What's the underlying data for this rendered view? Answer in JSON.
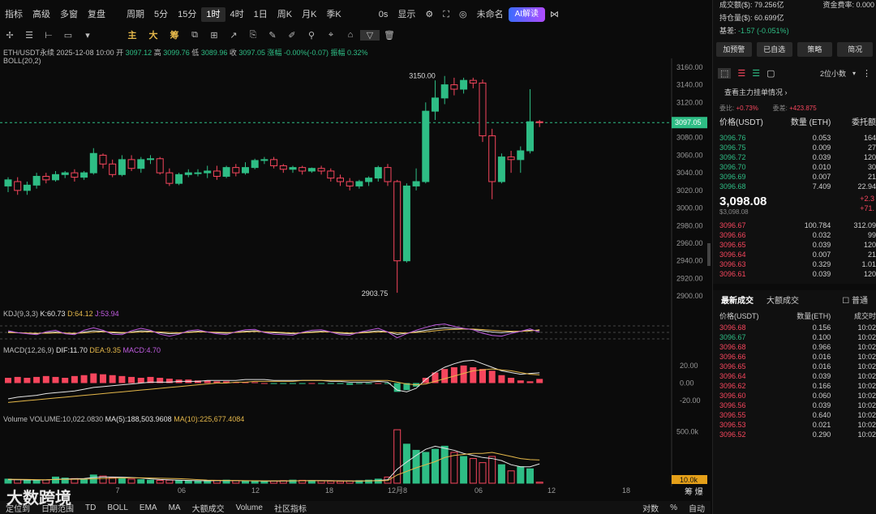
{
  "toolbar": {
    "items": [
      "指标",
      "高级",
      "多窗",
      "复盘",
      "周期",
      "5分",
      "15分",
      "1时",
      "4时",
      "1日",
      "周K",
      "月K",
      "季K",
      "0s",
      "显示",
      "未命名",
      "AI解读"
    ]
  },
  "drawbar": {
    "yellow": [
      "主",
      "大",
      "筹"
    ]
  },
  "info": {
    "pair": "ETH/USDT永续",
    "date": "2025-12-08 10:00",
    "open_label": "开",
    "open": "3097.12",
    "high_label": "高",
    "high": "3099.76",
    "low_label": "低",
    "low": "3089.96",
    "close_label": "收",
    "close": "3097.05",
    "chg": "涨幅 -0.00%(-0.07)",
    "amp": "振幅 0.32%"
  },
  "boll": "BOLL(20,2)",
  "kdj": {
    "label": "KDJ(9,3,3)",
    "k": "K:60.73",
    "d": "D:64.12",
    "j": "J:53.94"
  },
  "macd": {
    "label": "MACD(12,26,9)",
    "dif": "DIF:11.70",
    "dea": "DEA:9.35",
    "macd": "MACD:4.70"
  },
  "vol": {
    "label": "Volume",
    "v": "VOLUME:10,022.0830",
    "ma5": "MA(5):188,503.9608",
    "ma10": "MA(10):225,677.4084"
  },
  "price_ticks": [
    "3160.00",
    "3140.00",
    "3120.00",
    "3100.00",
    "3080.00",
    "3060.00",
    "3040.00",
    "3020.00",
    "3000.00",
    "2980.00",
    "2960.00",
    "2940.00",
    "2920.00",
    "2900.00"
  ],
  "last_price": "3097.05",
  "hi_label": "3150.00",
  "lo_label": "2903.75",
  "macd_ticks": [
    "20.00",
    "0.00",
    "-20.00"
  ],
  "vol_ticks": [
    "500.0k",
    "10.0k"
  ],
  "x_ticks": [
    "7",
    "06",
    "12",
    "18",
    "12月8",
    "06",
    "12",
    "18"
  ],
  "bottom": {
    "items": [
      "定位到",
      "日期范围",
      "TD",
      "BOLL",
      "EMA",
      "MA",
      "大额成交",
      "Volume",
      "社区指标",
      "对数",
      "%",
      "自动"
    ],
    "watermark": "大数跨境"
  },
  "right": {
    "stats": [
      {
        "k": "成交额($):",
        "v": "79.256亿"
      },
      {
        "k": "资金费率:",
        "v": "0.000"
      },
      {
        "k": "持仓量($):",
        "v": "60.699亿"
      },
      {
        "k": "基差:",
        "v": "-1.57 (-0.051%)"
      }
    ],
    "buttons": [
      "加预警",
      "已自选",
      "策略",
      "简况"
    ],
    "decimals": "2位小数",
    "depth_title": "查看主力挂单情况",
    "ratio": {
      "a_label": "委比:",
      "a": "+0.73%",
      "b_label": "委差:",
      "b": "+423.875"
    },
    "headers": [
      "价格(USDT)",
      "数量 (ETH)",
      "委托额"
    ],
    "asks": [
      [
        "3096.76",
        "0.053",
        "164"
      ],
      [
        "3096.75",
        "0.009",
        "27"
      ],
      [
        "3096.72",
        "0.039",
        "120"
      ],
      [
        "3096.70",
        "0.010",
        "30"
      ],
      [
        "3096.69",
        "0.007",
        "21"
      ],
      [
        "3096.68",
        "7.409",
        "22.94"
      ]
    ],
    "mid": {
      "price": "3,098.08",
      "usd": "$3,098.08",
      "chg": "+2.3",
      "chg2": "+71."
    },
    "bids": [
      [
        "3096.67",
        "100.784",
        "312.09"
      ],
      [
        "3096.66",
        "0.032",
        "99"
      ],
      [
        "3096.65",
        "0.039",
        "120"
      ],
      [
        "3096.64",
        "0.007",
        "21"
      ],
      [
        "3096.63",
        "0.329",
        "1.01"
      ],
      [
        "3096.61",
        "0.039",
        "120"
      ]
    ],
    "tabs": [
      "最新成交",
      "大额成交",
      "普通"
    ],
    "trade_headers": [
      "价格(USDT)",
      "数量(ETH)",
      "成交时"
    ],
    "trades": [
      [
        "3096.68",
        "0.156",
        "10:02"
      ],
      [
        "3096.67",
        "0.100",
        "10:02"
      ],
      [
        "3096.68",
        "0.966",
        "10:02"
      ],
      [
        "3096.66",
        "0.016",
        "10:02"
      ],
      [
        "3096.65",
        "0.016",
        "10:02"
      ],
      [
        "3096.64",
        "0.039",
        "10:02"
      ],
      [
        "3096.62",
        "0.166",
        "10:02"
      ],
      [
        "3096.60",
        "0.060",
        "10:02"
      ],
      [
        "3096.56",
        "0.039",
        "10:02"
      ],
      [
        "3096.55",
        "0.640",
        "10:02"
      ],
      [
        "3096.53",
        "0.021",
        "10:02"
      ],
      [
        "3096.52",
        "0.290",
        "10:02"
      ]
    ],
    "trade_colors": [
      "rd",
      "gr",
      "rd",
      "rd",
      "rd",
      "rd",
      "rd",
      "rd",
      "rd",
      "rd",
      "rd",
      "rd"
    ]
  },
  "colors": {
    "up": "#2ebd85",
    "down": "#f6465d",
    "k": "#e5e5e5",
    "d": "#e5b84a",
    "j": "#c05ce0"
  },
  "chart_data": {
    "type": "candlestick",
    "interval": "1h",
    "candles": [
      [
        3025,
        3032,
        3018,
        3035
      ],
      [
        3030,
        3020,
        3015,
        3035
      ],
      [
        3020,
        3026,
        3015,
        3030
      ],
      [
        3026,
        3036,
        3022,
        3040
      ],
      [
        3036,
        3032,
        3028,
        3040
      ],
      [
        3032,
        3038,
        3030,
        3042
      ],
      [
        3038,
        3040,
        3034,
        3042
      ],
      [
        3040,
        3035,
        3030,
        3044
      ],
      [
        3035,
        3040,
        3032,
        3042
      ],
      [
        3040,
        3062,
        3038,
        3068
      ],
      [
        3060,
        3050,
        3045,
        3062
      ],
      [
        3050,
        3038,
        3035,
        3055
      ],
      [
        3038,
        3055,
        3036,
        3060
      ],
      [
        3055,
        3045,
        3042,
        3060
      ],
      [
        3045,
        3055,
        3040,
        3058
      ],
      [
        3055,
        3056,
        3050,
        3060
      ],
      [
        3056,
        3040,
        3038,
        3058
      ],
      [
        3040,
        3028,
        3025,
        3045
      ],
      [
        3028,
        3038,
        3026,
        3040
      ],
      [
        3038,
        3040,
        3035,
        3044
      ],
      [
        3040,
        3040,
        3036,
        3044
      ],
      [
        3040,
        3042,
        3034,
        3048
      ],
      [
        3042,
        3036,
        3032,
        3048
      ],
      [
        3036,
        3046,
        3034,
        3048
      ],
      [
        3046,
        3040,
        3036,
        3050
      ],
      [
        3040,
        3046,
        3038,
        3052
      ],
      [
        3046,
        3054,
        3044,
        3056
      ],
      [
        3054,
        3055,
        3050,
        3058
      ],
      [
        3055,
        3048,
        3045,
        3058
      ],
      [
        3048,
        3044,
        3040,
        3050
      ],
      [
        3044,
        3046,
        3040,
        3048
      ],
      [
        3046,
        3042,
        3038,
        3048
      ],
      [
        3042,
        3045,
        3040,
        3046
      ],
      [
        3045,
        3042,
        3038,
        3048
      ],
      [
        3042,
        3034,
        3030,
        3045
      ],
      [
        3034,
        3030,
        3025,
        3038
      ],
      [
        3030,
        3025,
        3020,
        3034
      ],
      [
        3025,
        3030,
        3022,
        3032
      ],
      [
        3030,
        3034,
        3025,
        3036
      ],
      [
        3034,
        3046,
        3030,
        3048
      ],
      [
        3046,
        3030,
        3025,
        3050
      ],
      [
        3030,
        2940,
        2903.75,
        3032
      ],
      [
        2940,
        3025,
        2938,
        3028
      ],
      [
        3025,
        3030,
        3020,
        3045
      ],
      [
        3030,
        3110,
        3028,
        3120
      ],
      [
        3110,
        3125,
        3100,
        3145
      ],
      [
        3125,
        3140,
        3118,
        3150
      ],
      [
        3140,
        3135,
        3128,
        3148
      ],
      [
        3135,
        3145,
        3130,
        3148
      ],
      [
        3145,
        3142,
        3136,
        3148
      ],
      [
        3142,
        3082,
        3075,
        3146
      ],
      [
        3082,
        3030,
        3010,
        3090
      ],
      [
        3030,
        3058,
        3028,
        3062
      ],
      [
        3058,
        3055,
        3040,
        3065
      ],
      [
        3055,
        3065,
        3040,
        3070
      ],
      [
        3065,
        3098,
        3062,
        3135
      ],
      [
        3098,
        3097.05,
        3092,
        3100
      ]
    ],
    "kdj": {
      "k": [
        55,
        52,
        50,
        48,
        52,
        55,
        50,
        48,
        55,
        60,
        58,
        52,
        50,
        55,
        60,
        58,
        52,
        48,
        50,
        55,
        58,
        55,
        52,
        50,
        54,
        58,
        60,
        55,
        52,
        50,
        48,
        52,
        56,
        58,
        55,
        50,
        48,
        52,
        56,
        60,
        55,
        45,
        50,
        56,
        62,
        68,
        72,
        70,
        68,
        66,
        60,
        55,
        52,
        55,
        58,
        62,
        60.73
      ],
      "d": [
        52,
        52,
        51,
        50,
        50,
        51,
        51,
        50,
        51,
        54,
        56,
        55,
        53,
        53,
        55,
        56,
        55,
        53,
        52,
        53,
        55,
        55,
        54,
        53,
        53,
        55,
        57,
        56,
        55,
        53,
        51,
        51,
        53,
        55,
        55,
        53,
        51,
        51,
        53,
        55,
        55,
        52,
        51,
        53,
        56,
        60,
        64,
        66,
        67,
        67,
        65,
        62,
        59,
        58,
        58,
        59,
        64.12
      ],
      "j": [
        60,
        52,
        48,
        44,
        56,
        62,
        48,
        44,
        62,
        72,
        62,
        46,
        44,
        60,
        70,
        62,
        46,
        38,
        46,
        60,
        64,
        55,
        48,
        44,
        56,
        64,
        66,
        53,
        46,
        44,
        42,
        54,
        62,
        64,
        55,
        44,
        42,
        54,
        62,
        70,
        55,
        31,
        48,
        62,
        74,
        84,
        88,
        78,
        70,
        64,
        50,
        41,
        38,
        49,
        58,
        68,
        53.94
      ]
    },
    "macd": {
      "hist": [
        6,
        7,
        6,
        7,
        8,
        7,
        6,
        8,
        9,
        11,
        10,
        9,
        8,
        7,
        6,
        7,
        6,
        5,
        4,
        4,
        3,
        3,
        2,
        2,
        1,
        1,
        1,
        0,
        -1,
        -1,
        -1,
        -1,
        0,
        -1,
        -1,
        -1,
        -2,
        -1,
        -1,
        0,
        -1,
        -10,
        -8,
        -4,
        6,
        12,
        16,
        18,
        20,
        18,
        16,
        14,
        9,
        6,
        3,
        2,
        4.7
      ],
      "dif": [
        -18,
        -16,
        -15,
        -14,
        -12,
        -11,
        -10,
        -9,
        -7,
        -5,
        -4,
        -3,
        -2,
        -1,
        0,
        1,
        1,
        1,
        2,
        2,
        2,
        3,
        3,
        3,
        3,
        4,
        4,
        4,
        3,
        3,
        3,
        3,
        3,
        3,
        2,
        2,
        1,
        1,
        1,
        2,
        1,
        -8,
        -10,
        -6,
        4,
        12,
        18,
        22,
        25,
        26,
        22,
        18,
        14,
        12,
        10,
        11,
        11.7
      ],
      "dea": [
        -22,
        -21,
        -20,
        -19,
        -18,
        -17,
        -16,
        -15,
        -14,
        -13,
        -12,
        -11,
        -10,
        -9,
        -8,
        -7,
        -6,
        -5,
        -4,
        -3,
        -2,
        -1,
        0,
        0,
        1,
        1,
        2,
        2,
        2,
        2,
        2,
        3,
        3,
        3,
        3,
        3,
        3,
        3,
        3,
        3,
        3,
        1,
        -1,
        -2,
        -1,
        2,
        5,
        8,
        11,
        14,
        15,
        16,
        15,
        14,
        12,
        10,
        9.35
      ]
    },
    "volume": {
      "v": [
        40,
        35,
        30,
        28,
        32,
        60,
        50,
        45,
        40,
        80,
        70,
        55,
        45,
        40,
        35,
        30,
        28,
        30,
        25,
        22,
        20,
        25,
        28,
        30,
        25,
        22,
        20,
        18,
        20,
        25,
        30,
        28,
        25,
        22,
        20,
        18,
        22,
        25,
        30,
        40,
        60,
        520,
        380,
        320,
        300,
        330,
        360,
        300,
        260,
        240,
        200,
        260,
        180,
        120,
        160,
        140,
        10
      ],
      "ma5": [
        35,
        34,
        33,
        32,
        33,
        37,
        40,
        43,
        45,
        55,
        60,
        60,
        58,
        55,
        50,
        42,
        36,
        33,
        30,
        27,
        25,
        24,
        25,
        26,
        25,
        24,
        23,
        21,
        21,
        21,
        23,
        24,
        26,
        26,
        25,
        23,
        21,
        21,
        23,
        27,
        34,
        136,
        206,
        270,
        330,
        360,
        340,
        320,
        290,
        270,
        250,
        240,
        220,
        180,
        160,
        160,
        188.5
      ],
      "ma10": [
        38,
        37,
        36,
        35,
        34,
        36,
        37,
        38,
        39,
        42,
        46,
        48,
        50,
        52,
        52,
        50,
        48,
        46,
        44,
        40,
        35,
        30,
        28,
        27,
        26,
        25,
        24,
        23,
        23,
        23,
        24,
        24,
        25,
        24,
        23,
        22,
        22,
        22,
        23,
        24,
        26,
        80,
        115,
        150,
        180,
        210,
        250,
        270,
        280,
        290,
        290,
        300,
        280,
        260,
        240,
        230,
        225.7
      ]
    },
    "price_range": [
      2890,
      3170
    ]
  }
}
